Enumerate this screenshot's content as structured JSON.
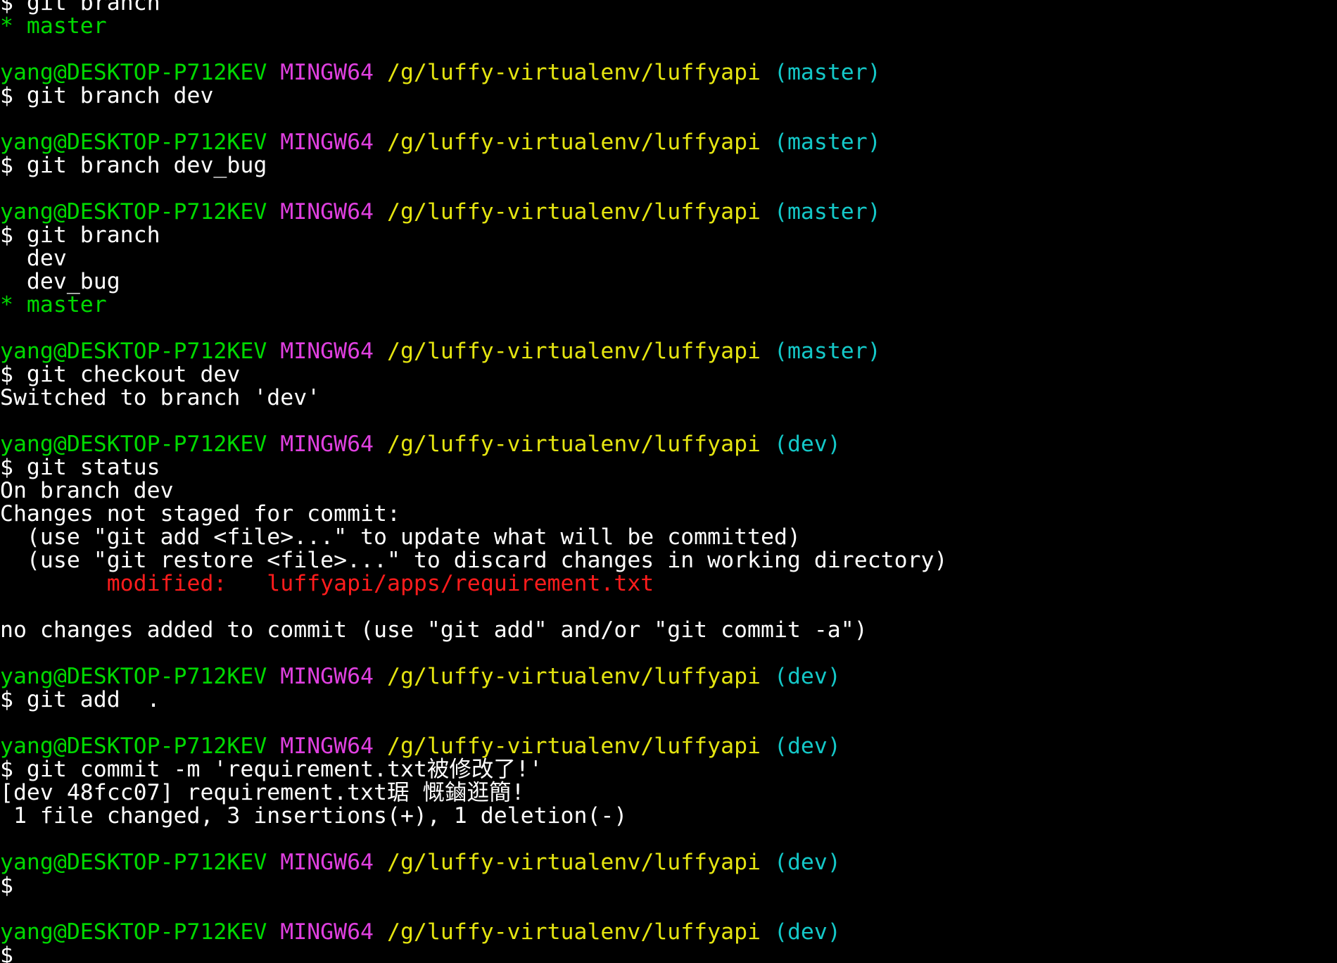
{
  "terminal": {
    "prompt_user_host": "yang@DESKTOP-P712KEV",
    "prompt_system": "MINGW64",
    "prompt_path": "/g/luffy-virtualenv/luffyapi",
    "prompt_symbol": "$",
    "colors": {
      "background": "#000000",
      "user_host": "#00d900",
      "system": "#e040e0",
      "path": "#e5e510",
      "branch": "#14c8c8",
      "text": "#ffffff",
      "current_branch": "#00d900",
      "modified": "#ff1c1c"
    },
    "blocks": [
      {
        "branch": "",
        "hide_prompt": true,
        "command": "$ git branch",
        "output": [
          {
            "type": "current",
            "text": "* master"
          },
          {
            "type": "blank",
            "text": ""
          }
        ]
      },
      {
        "branch": "(master)",
        "command": "$ git branch dev",
        "output": [
          {
            "type": "blank",
            "text": ""
          }
        ]
      },
      {
        "branch": "(master)",
        "command": "$ git branch dev_bug",
        "output": [
          {
            "type": "blank",
            "text": ""
          }
        ]
      },
      {
        "branch": "(master)",
        "command": "$ git branch",
        "output": [
          {
            "type": "plain",
            "text": "  dev"
          },
          {
            "type": "plain",
            "text": "  dev_bug"
          },
          {
            "type": "current",
            "text": "* master"
          },
          {
            "type": "blank",
            "text": ""
          }
        ]
      },
      {
        "branch": "(master)",
        "command": "$ git checkout dev",
        "output": [
          {
            "type": "plain",
            "text": "Switched to branch 'dev'"
          },
          {
            "type": "blank",
            "text": ""
          }
        ]
      },
      {
        "branch": "(dev)",
        "command": "$ git status",
        "output": [
          {
            "type": "plain",
            "text": "On branch dev"
          },
          {
            "type": "plain",
            "text": "Changes not staged for commit:"
          },
          {
            "type": "plain",
            "text": "  (use \"git add <file>...\" to update what will be committed)"
          },
          {
            "type": "plain",
            "text": "  (use \"git restore <file>...\" to discard changes in working directory)"
          },
          {
            "type": "modified",
            "text": "        modified:   luffyapi/apps/requirement.txt"
          },
          {
            "type": "blank",
            "text": ""
          },
          {
            "type": "plain",
            "text": "no changes added to commit (use \"git add\" and/or \"git commit -a\")"
          },
          {
            "type": "blank",
            "text": ""
          }
        ]
      },
      {
        "branch": "(dev)",
        "command": "$ git add  .",
        "output": [
          {
            "type": "blank",
            "text": ""
          }
        ]
      },
      {
        "branch": "(dev)",
        "command": "$ git commit -m 'requirement.txt被修改了!'",
        "output": [
          {
            "type": "plain",
            "text": "[dev 48fcc07] requirement.txt琚 慨鏀逛簡!"
          },
          {
            "type": "plain",
            "text": " 1 file changed, 3 insertions(+), 1 deletion(-)"
          },
          {
            "type": "blank",
            "text": ""
          }
        ]
      },
      {
        "branch": "(dev)",
        "command": "$",
        "output": [
          {
            "type": "blank",
            "text": ""
          }
        ]
      },
      {
        "branch": "(dev)",
        "command": "$",
        "output": []
      }
    ]
  }
}
